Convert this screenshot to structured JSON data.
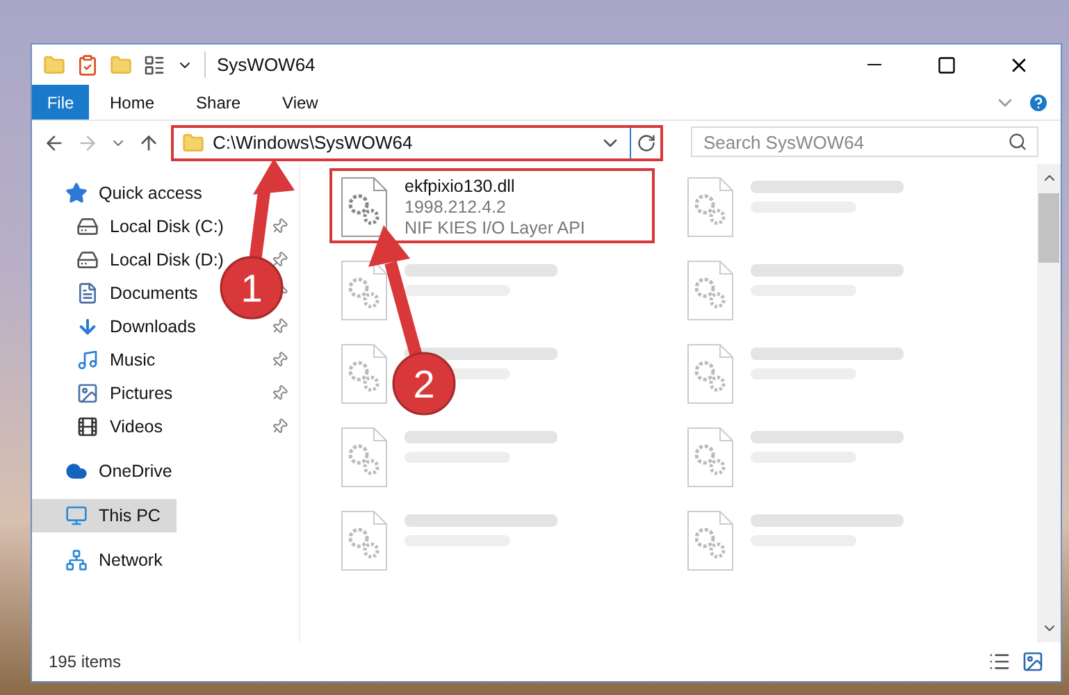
{
  "window": {
    "title": "SysWOW64"
  },
  "ribbon_tabs": [
    {
      "label": "File",
      "kind": "file"
    },
    {
      "label": "Home",
      "kind": "tab"
    },
    {
      "label": "Share",
      "kind": "tab"
    },
    {
      "label": "View",
      "kind": "tab"
    }
  ],
  "address": {
    "path": "C:\\Windows\\SysWOW64",
    "highlighted": true
  },
  "search": {
    "placeholder": "Search SysWOW64"
  },
  "sidebar": {
    "items": [
      {
        "label": "Quick access",
        "kind": "star",
        "selected": false,
        "children": [
          {
            "label": "Local Disk (C:)",
            "kind": "disk",
            "pinned": true,
            "selected": false
          },
          {
            "label": "Local Disk (D:)",
            "kind": "disk",
            "pinned": true,
            "selected": false
          },
          {
            "label": "Documents",
            "kind": "documents",
            "pinned": true,
            "selected": false
          },
          {
            "label": "Downloads",
            "kind": "downloads",
            "pinned": true,
            "selected": false
          },
          {
            "label": "Music",
            "kind": "music",
            "pinned": true,
            "selected": false
          },
          {
            "label": "Pictures",
            "kind": "pictures",
            "pinned": true,
            "selected": false
          },
          {
            "label": "Videos",
            "kind": "videos",
            "pinned": true,
            "selected": false
          }
        ]
      },
      {
        "label": "OneDrive",
        "kind": "cloud",
        "selected": false
      },
      {
        "label": "This PC",
        "kind": "pc",
        "selected": true
      },
      {
        "label": "Network",
        "kind": "network",
        "selected": false
      }
    ]
  },
  "files": [
    {
      "name": "ekfpixio130.dll",
      "details": [
        "1998.212.4.2",
        "NIF KIES I/O Layer API"
      ],
      "dimmed": false,
      "highlighted": true
    },
    {
      "dimmed": true,
      "highlighted": false
    },
    {
      "dimmed": true,
      "highlighted": false
    },
    {
      "dimmed": true,
      "highlighted": false
    },
    {
      "dimmed": true,
      "highlighted": false
    },
    {
      "dimmed": true,
      "highlighted": false
    },
    {
      "dimmed": true,
      "highlighted": false
    },
    {
      "dimmed": true,
      "highlighted": false
    },
    {
      "dimmed": true,
      "highlighted": false
    },
    {
      "dimmed": true,
      "highlighted": false
    }
  ],
  "status_bar": {
    "count": "195 items"
  },
  "annotations": [
    {
      "label": "1"
    },
    {
      "label": "2"
    }
  ]
}
